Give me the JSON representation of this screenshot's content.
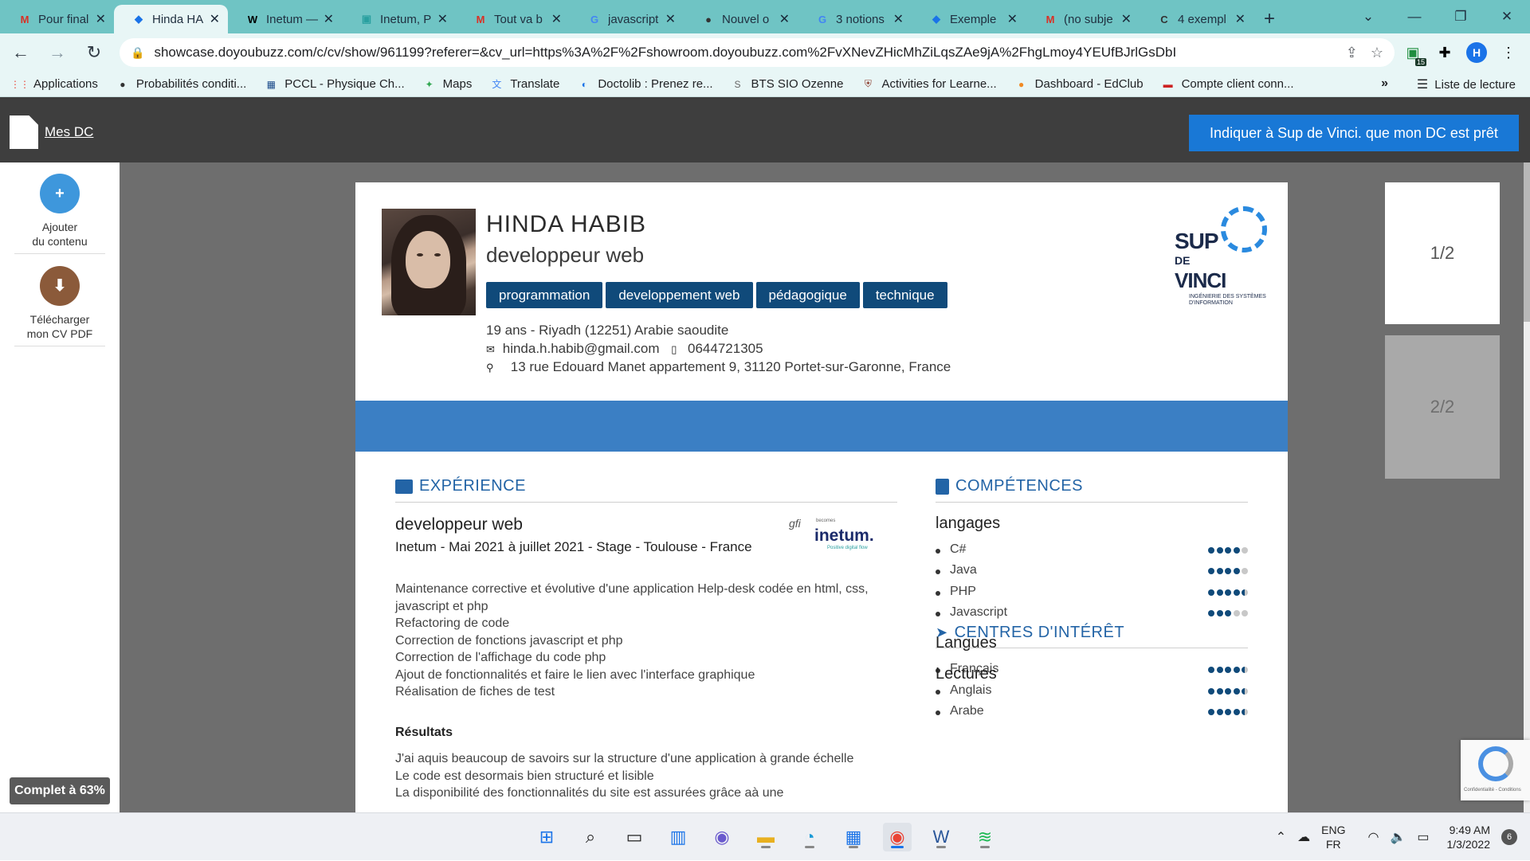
{
  "browser": {
    "tabs": [
      {
        "label": "Pour final",
        "icon": "gmail-icon",
        "color": "#d93025",
        "glyph": "M"
      },
      {
        "label": "Hinda HA",
        "icon": "doyoubuzz-icon",
        "color": "#1a73e8",
        "glyph": "◆",
        "active": true
      },
      {
        "label": "Inetum —",
        "icon": "wikipedia-icon",
        "color": "#000000",
        "glyph": "W"
      },
      {
        "label": "Inetum, P",
        "icon": "site-icon",
        "color": "#2aa0a0",
        "glyph": "▣"
      },
      {
        "label": "Tout va b",
        "icon": "gmail-icon",
        "color": "#d93025",
        "glyph": "M"
      },
      {
        "label": "javascript",
        "icon": "google-icon",
        "color": "#4285f4",
        "glyph": "G"
      },
      {
        "label": "Nouvel o",
        "icon": "github-icon",
        "color": "#333333",
        "glyph": "●"
      },
      {
        "label": "3 notions",
        "icon": "google-icon",
        "color": "#4285f4",
        "glyph": "G"
      },
      {
        "label": "Exemple",
        "icon": "site-icon",
        "color": "#1a73e8",
        "glyph": "◆"
      },
      {
        "label": "(no subje",
        "icon": "gmail-icon",
        "color": "#d93025",
        "glyph": "M"
      },
      {
        "label": "4 exempl",
        "icon": "site-icon",
        "color": "#333333",
        "glyph": "C"
      }
    ],
    "url": "showcase.doyoubuzz.com/c/cv/show/961199?referer=&cv_url=https%3A%2F%2Fshowroom.doyoubuzz.com%2FvXNevZHicMhZiLqsZAe9jA%2FhgLmoy4YEUfBJrlGsDbI",
    "ext_badge": "15",
    "profile_initial": "H",
    "bookmarks": [
      {
        "label": "Applications",
        "icon": "apps-icon",
        "color": "#ea4335",
        "glyph": "⋮⋮"
      },
      {
        "label": "Probabilités conditi...",
        "icon": "globe-icon",
        "color": "#333333",
        "glyph": "●"
      },
      {
        "label": "PCCL - Physique Ch...",
        "icon": "pccl-icon",
        "color": "#1a4a8a",
        "glyph": "▦"
      },
      {
        "label": "Maps",
        "icon": "maps-icon",
        "color": "#34a853",
        "glyph": "✦"
      },
      {
        "label": "Translate",
        "icon": "translate-icon",
        "color": "#4285f4",
        "glyph": "文"
      },
      {
        "label": "Doctolib : Prenez re...",
        "icon": "doctolib-icon",
        "color": "#1a73e8",
        "glyph": "◐"
      },
      {
        "label": "BTS SIO Ozenne",
        "icon": "sio-icon",
        "color": "#666666",
        "glyph": "S"
      },
      {
        "label": "Activities for Learne...",
        "icon": "shield-icon",
        "color": "#8a3a2a",
        "glyph": "⛨"
      },
      {
        "label": "Dashboard - EdClub",
        "icon": "edclub-icon",
        "color": "#f08a24",
        "glyph": "●"
      },
      {
        "label": "Compte client conn...",
        "icon": "account-icon",
        "color": "#cc2222",
        "glyph": "▬"
      }
    ],
    "more_bookmarks": "»",
    "reading_list": "Liste de lecture"
  },
  "app_header": {
    "my_dc": "Mes DC",
    "ready_button": "Indiquer à Sup de Vinci. que mon DC est prêt"
  },
  "sidebar": {
    "add_content": [
      "Ajouter",
      "du contenu"
    ],
    "download_pdf": [
      "Télécharger",
      "mon CV PDF"
    ],
    "complete": "Complet à 63%",
    "complete_value": 63
  },
  "cv": {
    "name": "HINDA HABIB",
    "title": "developpeur web",
    "tags": [
      "programmation",
      "developpement web",
      "pédagogique",
      "technique"
    ],
    "age_location": "19 ans - Riyadh (12251) Arabie saoudite",
    "email": "hinda.h.habib@gmail.com",
    "phone": "0644721305",
    "address": "13 rue Edouard Manet appartement 9, 31120 Portet-sur-Garonne, France",
    "school_logo": {
      "sup": "SUP",
      "de": "DE",
      "vinci": "VINCI",
      "subtitle": "INGÉNIERIE DES SYSTÈMES D'INFORMATION"
    },
    "experience": {
      "heading": "EXPÉRIENCE",
      "job_title": "developpeur web",
      "company_line": "Inetum - Mai 2021 à juillet 2021 - Stage - Toulouse - France",
      "logo_gfi": "gfi",
      "logo_becomes": "becomes",
      "logo_word": "inetum.",
      "logo_tagline": "Positive digital flow",
      "description": [
        "Maintenance corrective et évolutive d'une application Help-desk codée en html, css, javascript et php",
        "Refactoring de code",
        "Correction de fonctions javascript et php",
        "Correction de l'affichage du code php",
        "Ajout de fonctionnalités et faire le lien avec l'interface graphique",
        "Réalisation de fiches de test"
      ],
      "results_heading": "Résultats",
      "results": [
        "J'ai aquis beaucoup de savoirs sur la structure d'une application à grande échelle",
        "Le code est desormais bien structuré et lisible",
        "La disponibilité des fonctionnalités du site est assurées grâce aà une"
      ]
    },
    "skills": {
      "heading": "COMPÉTENCES",
      "groups": [
        {
          "name": "langages",
          "items": [
            {
              "label": "C#",
              "level": 4
            },
            {
              "label": "Java",
              "level": 4
            },
            {
              "label": "PHP",
              "level": 4.5
            },
            {
              "label": "Javascript",
              "level": 3
            }
          ]
        },
        {
          "name": "Langues",
          "items": [
            {
              "label": "Français",
              "level": 4.5
            },
            {
              "label": "Anglais",
              "level": 4.5
            },
            {
              "label": "Arabe",
              "level": 4.5
            }
          ]
        }
      ]
    },
    "interests": {
      "heading": "CENTRES D'INTÉRÊT",
      "first": "Lectures"
    }
  },
  "pages": {
    "page1": "1/2",
    "page2": "2/2"
  },
  "recaptcha": "Confidentialité - Conditions",
  "taskbar": {
    "apps": [
      {
        "name": "start-icon",
        "glyph": "⊞",
        "color": "#1a73e8"
      },
      {
        "name": "search-icon",
        "glyph": "⌕",
        "color": "#222222"
      },
      {
        "name": "task-view-icon",
        "glyph": "▭",
        "color": "#222222"
      },
      {
        "name": "widgets-icon",
        "glyph": "▥",
        "color": "#1a73e8"
      },
      {
        "name": "chat-icon",
        "glyph": "◉",
        "color": "#6a5acd"
      },
      {
        "name": "file-explorer-icon",
        "glyph": "▬",
        "color": "#e8b020"
      },
      {
        "name": "edge-icon",
        "glyph": "◔",
        "color": "#1a9ad6"
      },
      {
        "name": "store-icon",
        "glyph": "▦",
        "color": "#1a73e8"
      },
      {
        "name": "chrome-icon",
        "glyph": "◉",
        "color": "#ea4335",
        "active": true
      },
      {
        "name": "word-icon",
        "glyph": "W",
        "color": "#2b579a"
      },
      {
        "name": "spotify-icon",
        "glyph": "≋",
        "color": "#1db954"
      }
    ],
    "lang_top": "ENG",
    "lang_bottom": "FR",
    "time": "9:49 AM",
    "date": "1/3/2022",
    "notifications": "6"
  }
}
